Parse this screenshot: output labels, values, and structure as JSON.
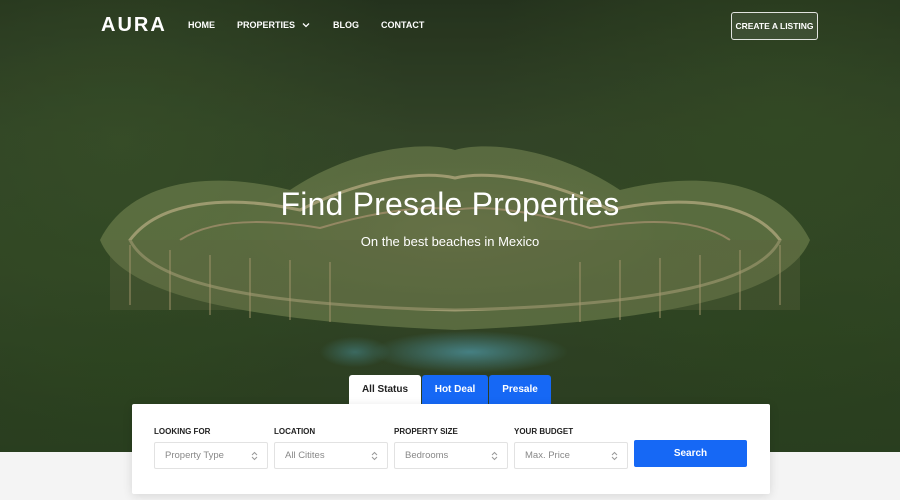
{
  "brand": {
    "logo_text": "AURA"
  },
  "nav": {
    "items": [
      {
        "label": "HOME"
      },
      {
        "label": "PROPERTIES"
      },
      {
        "label": "BLOG"
      },
      {
        "label": "CONTACT"
      }
    ],
    "cta_label": "CREATE A LISTING"
  },
  "hero": {
    "title": "Find Presale Properties",
    "subtitle": "On the best beaches in Mexico"
  },
  "tabs": [
    {
      "label": "All Status",
      "active": true
    },
    {
      "label": "Hot Deal",
      "active": false
    },
    {
      "label": "Presale",
      "active": false
    }
  ],
  "search": {
    "fields": [
      {
        "label": "LOOKING FOR",
        "value": "Property Type"
      },
      {
        "label": "LOCATION",
        "value": "All Citites"
      },
      {
        "label": "PROPERTY SIZE",
        "value": "Bedrooms"
      },
      {
        "label": "YOUR BUDGET",
        "value": "Max. Price"
      }
    ],
    "button_label": "Search"
  },
  "colors": {
    "accent": "#1668f5",
    "panel": "#ffffff",
    "page_bg": "#f4f4f4"
  }
}
